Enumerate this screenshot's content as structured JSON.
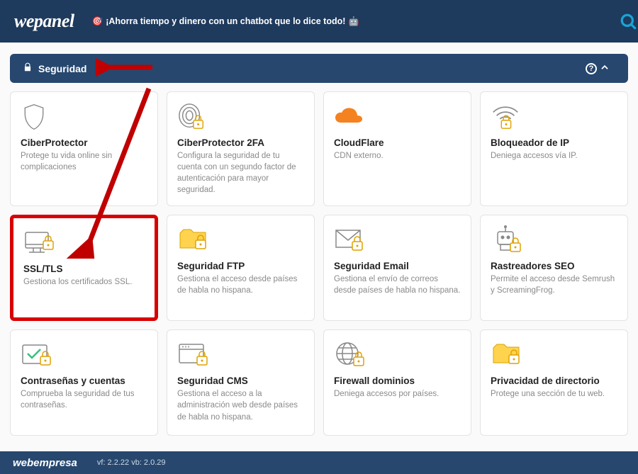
{
  "header": {
    "logo": "wepanel",
    "promo": "¡Ahorra tiempo y dinero con un chatbot que lo dice todo!"
  },
  "section": {
    "title": "Seguridad"
  },
  "cards": [
    {
      "title": "CiberProtector",
      "desc": "Protege tu vida online sin complicaciones"
    },
    {
      "title": "CiberProtector 2FA",
      "desc": "Configura la seguridad de tu cuenta con un segundo factor de autenticación para mayor seguridad."
    },
    {
      "title": "CloudFlare",
      "desc": "CDN externo."
    },
    {
      "title": "Bloqueador de IP",
      "desc": "Deniega accesos vía IP."
    },
    {
      "title": "SSL/TLS",
      "desc": "Gestiona los certificados SSL."
    },
    {
      "title": "Seguridad FTP",
      "desc": "Gestiona el acceso desde países de habla no hispana."
    },
    {
      "title": "Seguridad Email",
      "desc": "Gestiona el envío de correos desde países de habla no hispana."
    },
    {
      "title": "Rastreadores SEO",
      "desc": "Permite el acceso desde Semrush y ScreamingFrog."
    },
    {
      "title": "Contraseñas y cuentas",
      "desc": "Comprueba la seguridad de tus contraseñas."
    },
    {
      "title": "Seguridad CMS",
      "desc": "Gestiona el acceso a la administración web desde países de habla no hispana."
    },
    {
      "title": "Firewall dominios",
      "desc": "Deniega accesos por países."
    },
    {
      "title": "Privacidad de directorio",
      "desc": "Protege una sección de tu web."
    }
  ],
  "footer": {
    "logo": "webempresa",
    "version": "vf: 2.2.22 vb: 2.0.29"
  }
}
